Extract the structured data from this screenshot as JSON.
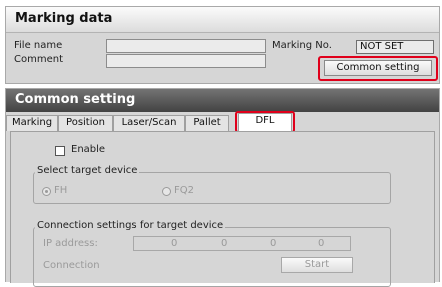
{
  "marking_data": {
    "title": "Marking data",
    "file_name_label": "File name",
    "comment_label": "Comment",
    "marking_no_label": "Marking No.",
    "marking_no_value": "NOT SET",
    "common_setting_button": "Common setting"
  },
  "common_setting": {
    "title": "Common setting",
    "tabs": [
      {
        "label": "Marking"
      },
      {
        "label": "Position"
      },
      {
        "label": "Laser/Scan"
      },
      {
        "label": "Pallet"
      },
      {
        "label": "DFL"
      }
    ],
    "enable_label": "Enable",
    "select_target_legend": "Select target device",
    "device_options": [
      "FH",
      "FQ2"
    ],
    "selected_device": "FH",
    "connection_legend": "Connection settings for target device",
    "ip_label": "IP address:",
    "ip_octets": [
      "0",
      "0",
      "0",
      "0"
    ],
    "connection_label": "Connection",
    "start_button": "Start"
  },
  "highlight_color": "#e0001b"
}
